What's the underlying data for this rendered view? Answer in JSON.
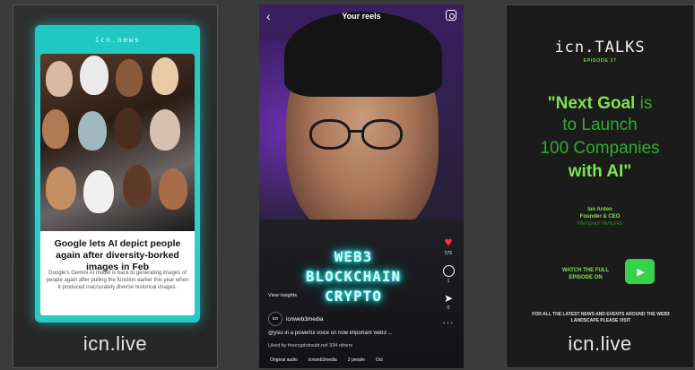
{
  "panel_news": {
    "brand": "icn.news",
    "headline": "Google lets AI depict people again after diversity-borked images in Feb",
    "body": "Google's Gemini AI model is back to generating images of people again after pulling the function earlier this year when it produced inaccurately diverse historical images.",
    "footer_logo": "icn.live",
    "accent": "#22cdc9"
  },
  "panel_reel": {
    "title": "Your reels",
    "neon_lines": [
      "WEB3",
      "BLOCKCHAIN",
      "CRYPTO"
    ],
    "like_count": "576",
    "comment_count": "1",
    "share_count": "0",
    "insights": "View insights",
    "avatar": "icn",
    "username": "icnweb3media",
    "caption": "@ysiu in a powerful voice on how important web3 ...",
    "liked_by": "Liked by thecryptoinsidr.net 334 others",
    "bottom_audio": "Original audio",
    "bottom_user": "icnweb3media",
    "bottom_people": "2 people",
    "bottom_extra": "Oct"
  },
  "panel_talks": {
    "logo": "icn.TALKS",
    "episode": "EPISODE 27",
    "quote": {
      "line1_bold": "\"Next Goal",
      "line1_light": " is",
      "line2": "to Launch",
      "line3": "100 Companies",
      "line4": "with AI\""
    },
    "speaker_name": "Ian Arden",
    "speaker_role": "Founder & CEO",
    "speaker_company": "Mempool Ventures",
    "watch": "WATCH THE FULL EPISODE ON",
    "visit": "FOR ALL THE LATEST NEWS AND EVENTS AROUND THE WEB3 LANDSCAPE PLEASE VISIT",
    "footer_logo": "icn.live",
    "accent": "#7fe34a"
  }
}
